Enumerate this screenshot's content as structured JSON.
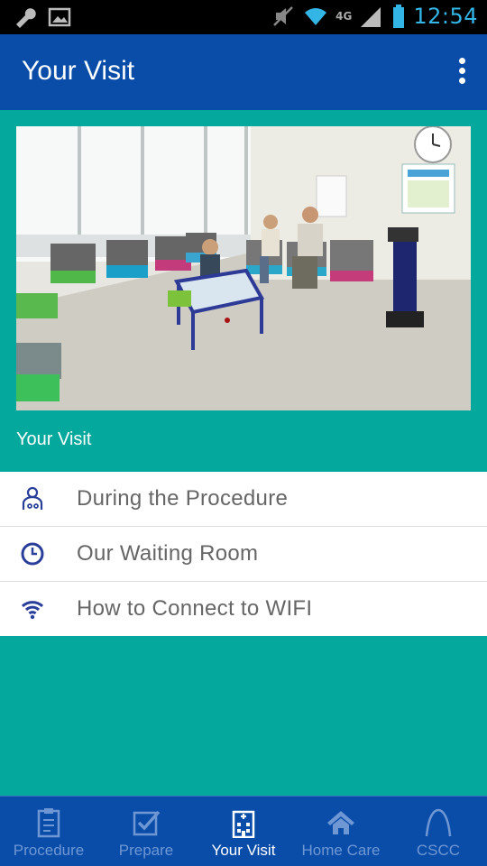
{
  "status_bar": {
    "time": "12:54",
    "network": "4G"
  },
  "action_bar": {
    "title": "Your Visit",
    "overflow_icon": "more-vert-icon"
  },
  "hero": {
    "caption": "Your Visit"
  },
  "list": {
    "items": [
      {
        "label": "During the Procedure",
        "icon": "doctor-icon"
      },
      {
        "label": "Our Waiting Room",
        "icon": "clock-icon"
      },
      {
        "label": "How to Connect to WIFI",
        "icon": "wifi-icon"
      }
    ]
  },
  "bottom_nav": {
    "tabs": [
      {
        "label": "Procedure",
        "icon": "clipboard-icon",
        "active": false
      },
      {
        "label": "Prepare",
        "icon": "checkbox-icon",
        "active": false
      },
      {
        "label": "Your Visit",
        "icon": "hospital-icon",
        "active": true
      },
      {
        "label": "Home Care",
        "icon": "home-icon",
        "active": false
      },
      {
        "label": "CSCC",
        "icon": "arch-icon",
        "active": false
      }
    ]
  },
  "colors": {
    "primary": "#0a4da9",
    "background": "#05a89c",
    "list_icon": "#2a3f99",
    "inactive_tab": "#6e97d3"
  }
}
